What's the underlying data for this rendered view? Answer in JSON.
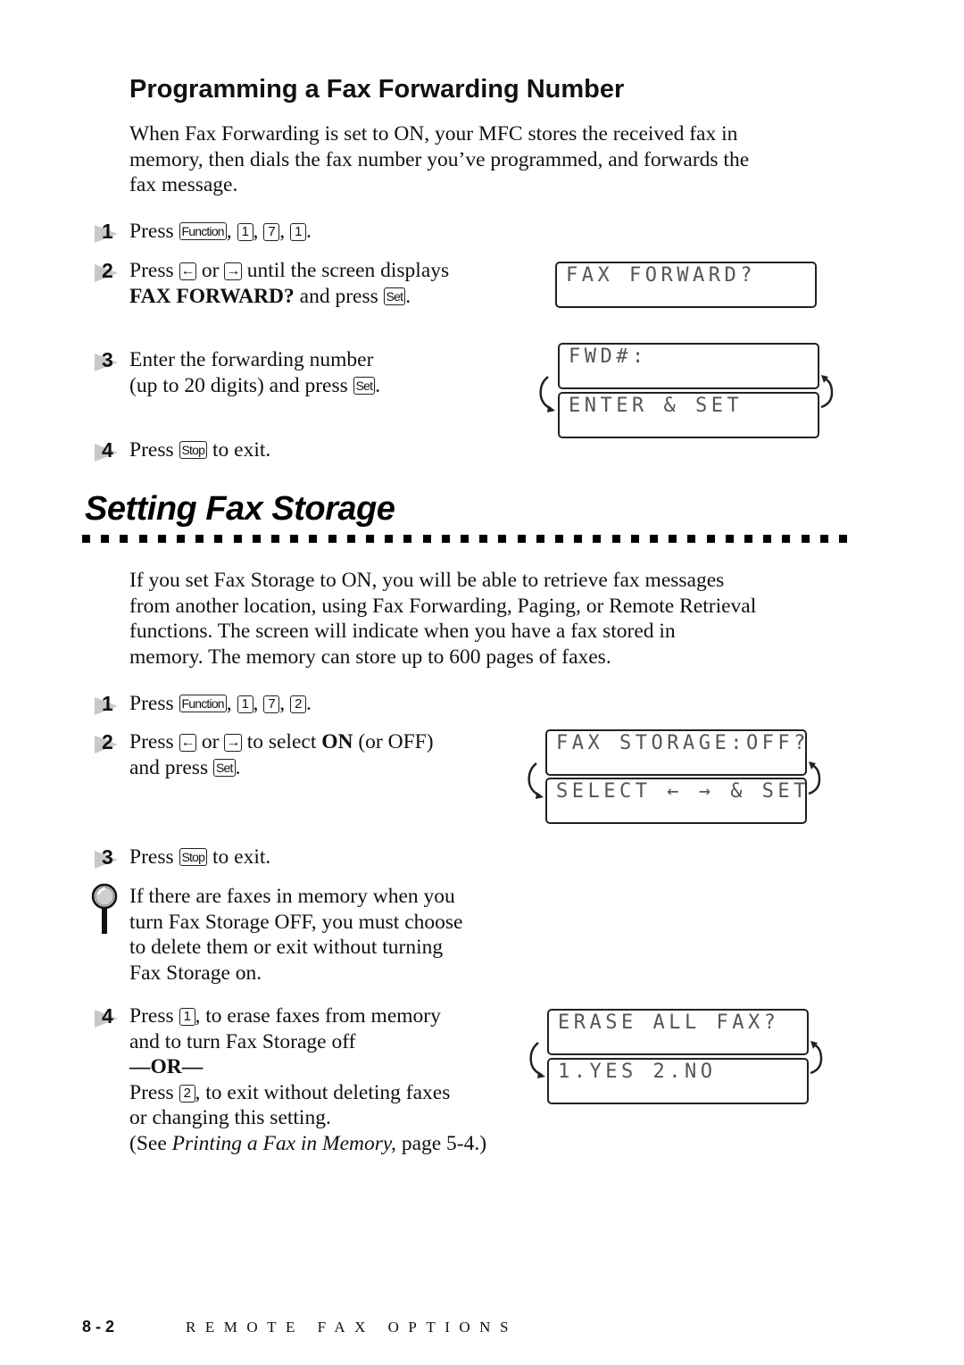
{
  "section1": {
    "title": "Programming a Fax Forwarding Number",
    "intro": [
      "When Fax Forwarding is set to ON, your MFC stores the received fax in",
      "memory, then dials the fax number you’ve programmed, and forwards the",
      "fax message."
    ],
    "steps": [
      {
        "num": "1",
        "press": "Press",
        "keys": [
          "Function",
          "1",
          "7",
          "1"
        ]
      },
      {
        "num": "2",
        "press": "Press",
        "key_left": "←",
        "or": "or",
        "key_right": "→",
        "rest1": "until the screen displays",
        "bold": "FAX FORWARD?",
        "rest2": "and press",
        "key_set": "Set"
      },
      {
        "num": "3",
        "line1": "Enter the forwarding number",
        "line2": "(up to 20 digits) and press",
        "key_set": "Set"
      },
      {
        "num": "4",
        "press": "Press",
        "key_stop": "Stop",
        "rest": "to exit."
      }
    ],
    "lcd": {
      "single": "FAX FORWARD?",
      "pair_top": "FWD#:",
      "pair_bottom": "ENTER & SET"
    }
  },
  "section2": {
    "title": "Setting Fax Storage",
    "intro": [
      "If you set Fax Storage to ON, you will be able to retrieve fax messages",
      "from another location, using Fax Forwarding, Paging, or Remote Retrieval",
      "functions.  The screen will indicate when you have a fax stored in",
      "memory. The memory can store up to 600 pages of faxes."
    ],
    "steps": [
      {
        "num": "1",
        "press": "Press",
        "keys": [
          "Function",
          "1",
          "7",
          "2"
        ]
      },
      {
        "num": "2",
        "press": "Press",
        "key_left": "←",
        "or": "or",
        "key_right": "→",
        "rest1": "to select",
        "bold": "ON",
        "rest2": "(or OFF)",
        "line2": "and press",
        "key_set": "Set"
      },
      {
        "num": "3",
        "press": "Press",
        "key_stop": "Stop",
        "rest": "to exit."
      },
      {
        "num": "4",
        "press": "Press",
        "key_1": "1",
        "line1_rest": ", to erase faxes from memory",
        "line2": "and to turn Fax Storage off",
        "or_label": "—OR—",
        "key_2": "2",
        "line4_rest": ", to exit without deleting faxes",
        "line5": "or changing this setting.",
        "see_open": "(See",
        "see_italic": "Printing a Fax in Memory,",
        "see_close": "page 5-4.)"
      }
    ],
    "note": {
      "icon": "magnifier-icon",
      "lines": [
        "If there are faxes in memory when you",
        "turn Fax Storage OFF, you must choose",
        "to delete them or exit without turning",
        "Fax Storage on."
      ]
    },
    "lcd": {
      "pair1_top": "FAX STORAGE:OFF?",
      "pair1_bottom": "SELECT ← → & SET",
      "pair2_top": "ERASE ALL FAX?",
      "pair2_bottom": "1.YES 2.NO"
    }
  },
  "footer": {
    "page": "8 - 2",
    "chapter": "REMOTE FAX OPTIONS"
  }
}
